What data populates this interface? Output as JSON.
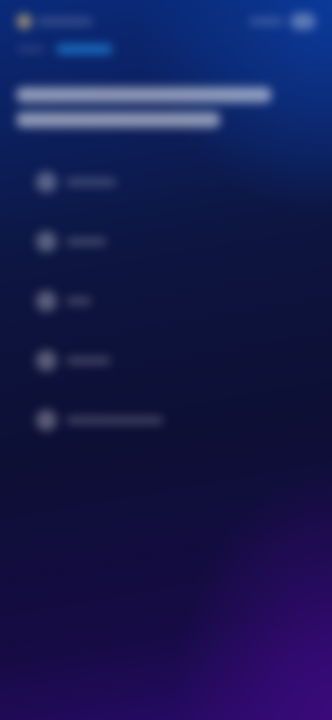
{
  "header": {
    "brand_icon": "brand-logo-icon",
    "avatar_icon": "avatar-icon"
  },
  "tabs": [
    {
      "active": false
    },
    {
      "active": true
    }
  ],
  "list": [
    {
      "icon": "circle-icon"
    },
    {
      "icon": "circle-icon"
    },
    {
      "icon": "circle-icon"
    },
    {
      "icon": "circle-icon"
    },
    {
      "icon": "circle-icon"
    }
  ],
  "colors": {
    "accent": "#1e7fd6",
    "background_top": "#0a2a7a",
    "background_mid": "#0d0f35",
    "background_bottom": "#2a0a6a",
    "brand_dot": "#b7a77a"
  }
}
